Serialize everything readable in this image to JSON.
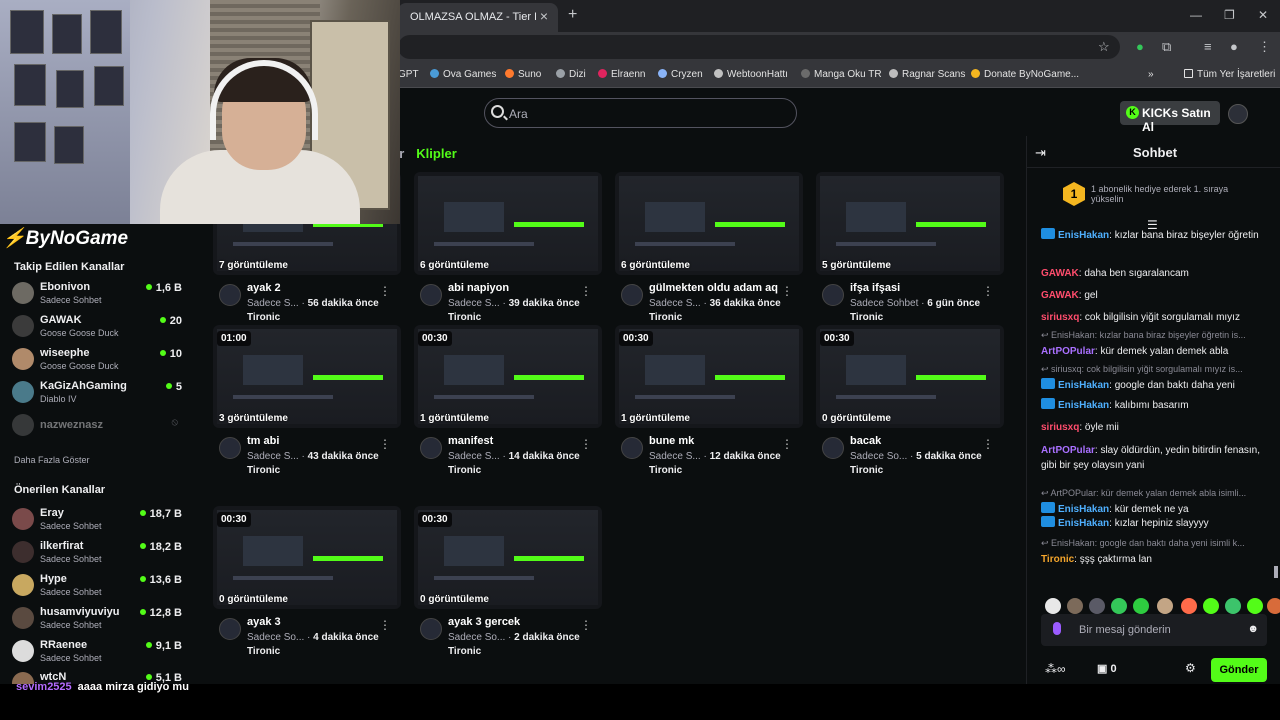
{
  "browser": {
    "tab_title": "OLMAZSA OLMAZ - Tier List, K",
    "bookmarks": [
      "GPT",
      "Ova Games",
      "Suno",
      "Dizi",
      "Elraenn",
      "Cryzen",
      "WebtoonHattı",
      "Manga Oku TR",
      "Ragnar Scans",
      "Donate ByNoGame...",
      "Tüm Yer İşaretleri"
    ]
  },
  "header": {
    "search_placeholder": "Ara",
    "kicks_label": "KICKs Satın Al"
  },
  "tabs": {
    "prev_fragment": "ar",
    "active": "Klipler"
  },
  "videos": [
    {
      "duration": "",
      "views": "7 görüntüleme",
      "title": "ayak 2",
      "category": "Sadece S...",
      "age": "56 dakika önce",
      "channel": "Tironic"
    },
    {
      "duration": "",
      "views": "6 görüntüleme",
      "title": "abi napiyon",
      "category": "Sadece S...",
      "age": "39 dakika önce",
      "channel": "Tironic"
    },
    {
      "duration": "",
      "views": "6 görüntüleme",
      "title": "gülmekten oldu adam aq",
      "category": "Sadece S...",
      "age": "36 dakika önce",
      "channel": "Tironic"
    },
    {
      "duration": "",
      "views": "5 görüntüleme",
      "title": "ifşa ifşasi",
      "category": "Sadece Sohbet",
      "age": "6 gün önce",
      "channel": "Tironic"
    },
    {
      "duration": "01:00",
      "views": "3 görüntüleme",
      "title": "tm abi",
      "category": "Sadece S...",
      "age": "43 dakika önce",
      "channel": "Tironic"
    },
    {
      "duration": "00:30",
      "views": "1 görüntüleme",
      "title": "manifest",
      "category": "Sadece S...",
      "age": "14 dakika önce",
      "channel": "Tironic"
    },
    {
      "duration": "00:30",
      "views": "1 görüntüleme",
      "title": "bune mk",
      "category": "Sadece S...",
      "age": "12 dakika önce",
      "channel": "Tironic"
    },
    {
      "duration": "00:30",
      "views": "0 görüntüleme",
      "title": "bacak",
      "category": "Sadece So...",
      "age": "5 dakika önce",
      "channel": "Tironic"
    },
    {
      "duration": "00:30",
      "views": "0 görüntüleme",
      "title": "ayak 3",
      "category": "Sadece So...",
      "age": "4 dakika önce",
      "channel": "Tironic"
    },
    {
      "duration": "00:30",
      "views": "0 görüntüleme",
      "title": "ayak 3 gercek",
      "category": "Sadece So...",
      "age": "2 dakika önce",
      "channel": "Tironic"
    }
  ],
  "sidebar": {
    "logo": "ByNoGame",
    "followed_title": "Takip Edilen Kanallar",
    "followed": [
      {
        "name": "Ebonivon",
        "game": "Sadece Sohbet",
        "viewers": "1,6 B"
      },
      {
        "name": "GAWAK",
        "game": "Goose Goose Duck",
        "viewers": "20"
      },
      {
        "name": "wiseephe",
        "game": "Goose Goose Duck",
        "viewers": "10"
      },
      {
        "name": "KaGizAhGaming",
        "game": "Diablo IV",
        "viewers": "5"
      },
      {
        "name": "nazweznasz",
        "game": "",
        "viewers": ""
      }
    ],
    "show_more": "Daha Fazla Göster",
    "recommended_title": "Önerilen Kanallar",
    "recommended": [
      {
        "name": "Eray",
        "game": "Sadece Sohbet",
        "viewers": "18,7 B"
      },
      {
        "name": "ilkerfirat",
        "game": "Sadece Sohbet",
        "viewers": "18,2 B"
      },
      {
        "name": "Hype",
        "game": "Sadece Sohbet",
        "viewers": "13,6 B"
      },
      {
        "name": "husamviyuviyu",
        "game": "Sadece Sohbet",
        "viewers": "12,8 B"
      },
      {
        "name": "RRaenee",
        "game": "Sadece Sohbet",
        "viewers": "9,1 B"
      },
      {
        "name": "wtcN",
        "game": "",
        "viewers": "5,1 B"
      }
    ]
  },
  "chat": {
    "title": "Sohbet",
    "gift_rank": "1",
    "gift_text": "1 abonelik hediye ederek 1. sıraya yükselin",
    "messages": [
      {
        "user": "EnisHakan",
        "color": "#4fb0ff",
        "badge": true,
        "text": ": kızlar bana biraz bişeyler öğretin",
        "reply": ""
      },
      {
        "user": "GAWAK",
        "color": "#ff4d6d",
        "badge": false,
        "text": ": daha ben sıgaralancam",
        "reply": ""
      },
      {
        "user": "GAWAK",
        "color": "#ff4d6d",
        "badge": false,
        "text": ": gel",
        "reply": ""
      },
      {
        "user": "siriusxq",
        "color": "#ff4d6d",
        "badge": false,
        "text": ": cok bilgilisin yiğit sorgulamalı mıyız",
        "reply": ""
      },
      {
        "user": "ArtPOPular",
        "color": "#a970ff",
        "badge": false,
        "text": ": kür demek yalan demek abla",
        "reply": "EnisHakan: kızlar bana biraz bişeyler öğretin is..."
      },
      {
        "user": "EnisHakan",
        "color": "#4fb0ff",
        "badge": true,
        "text": ": google dan baktı daha yeni",
        "reply": "siriusxq: cok bilgilisin yiğit sorgulamalı mıyız is..."
      },
      {
        "user": "EnisHakan",
        "color": "#4fb0ff",
        "badge": true,
        "text": ": kalıbımı basarım",
        "reply": ""
      },
      {
        "user": "siriusxq",
        "color": "#ff4d6d",
        "badge": false,
        "text": ": öyle mii",
        "reply": ""
      },
      {
        "user": "ArtPOPular",
        "color": "#a970ff",
        "badge": false,
        "text": ": slay öldürdün, yedin bitirdin fenasın, gibi bir şey olaysın yani",
        "reply": ""
      },
      {
        "user": "EnisHakan",
        "color": "#4fb0ff",
        "badge": true,
        "text": ": kür demek ne ya",
        "reply": "ArtPOPular: kür demek yalan demek abla isimli..."
      },
      {
        "user": "EnisHakan",
        "color": "#4fb0ff",
        "badge": true,
        "text": ": kızlar hepiniz slayyyy",
        "reply": ""
      },
      {
        "user": "Tironic",
        "color": "#f4a52c",
        "badge": false,
        "text": ": şşş çaktırma lan",
        "reply": "EnisHakan: google dan baktı daha yeni isimli k..."
      }
    ],
    "input_placeholder": "Bir mesaj gönderin",
    "footer_count": "0",
    "send_label": "Gönder"
  },
  "bottom_chat": {
    "user": "sevim2525",
    "text": "aaaa mirza gidiyo mu"
  },
  "colors": {
    "accent": "#53fc18",
    "background": "#0b0e0f"
  }
}
